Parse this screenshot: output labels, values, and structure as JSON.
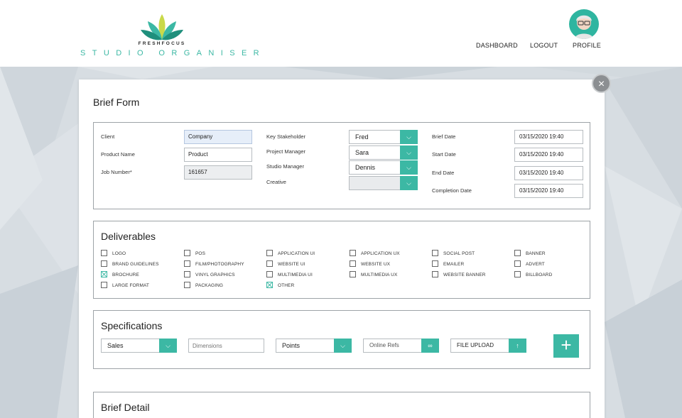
{
  "brand": {
    "small": "FRESHFOCUS",
    "big": "STUDIO ORGANISER"
  },
  "nav": {
    "dashboard": "DASHBOARD",
    "logout": "LOGOUT",
    "profile": "PROFILE"
  },
  "icons": {
    "close": "close-icon",
    "dropdown": "chevron-down-icon",
    "link": "link-icon",
    "upload": "arrow-up-icon",
    "add": "plus-icon"
  },
  "colors": {
    "accent": "#3cb8a4",
    "background": "#d9dee3"
  },
  "form": {
    "title": "Brief Form",
    "client": {
      "label": "Client",
      "value": "Company"
    },
    "product_name": {
      "label": "Product Name",
      "value": "Product"
    },
    "job_number": {
      "label": "Job Number*",
      "value": "161657"
    },
    "key_stakeholder": {
      "label": "Key Stakeholder",
      "value": "Fred"
    },
    "project_manager": {
      "label": "Project Manager",
      "value": "Sara"
    },
    "studio_manager": {
      "label": "Studio Manager",
      "value": "Dennis"
    },
    "creative": {
      "label": "Creative",
      "value": ""
    },
    "brief_date": {
      "label": "Brief Date",
      "value": "03/15/2020 19:40"
    },
    "start_date": {
      "label": "Start Date",
      "value": "03/15/2020 19:40"
    },
    "end_date": {
      "label": "End Date",
      "value": "03/15/2020 19:40"
    },
    "completion_date": {
      "label": "Completion Date",
      "value": "03/15/2020 19:40"
    }
  },
  "deliverables": {
    "title": "Deliverables",
    "items": [
      {
        "label": "LOGO",
        "checked": false
      },
      {
        "label": "BRAND GUIDELINES",
        "checked": false
      },
      {
        "label": "BROCHURE",
        "checked": true
      },
      {
        "label": "LARGE FORMAT",
        "checked": false
      },
      {
        "label": "POS",
        "checked": false
      },
      {
        "label": "FILM/PHOTOGRAPHY",
        "checked": false
      },
      {
        "label": "VINYL GRAPHICS",
        "checked": false
      },
      {
        "label": "PACKAGING",
        "checked": false
      },
      {
        "label": "APPLICATION UI",
        "checked": false
      },
      {
        "label": "WEBSITE UI",
        "checked": false
      },
      {
        "label": "MULTIMEDIA UI",
        "checked": false
      },
      {
        "label": "OTHER",
        "checked": true
      },
      {
        "label": "APPLICATION UX",
        "checked": false
      },
      {
        "label": "WEBSITE UX",
        "checked": false
      },
      {
        "label": "MULTIMEDIA UX",
        "checked": false
      },
      {
        "label": "SOCIAL POST",
        "checked": false
      },
      {
        "label": "EMAILER",
        "checked": false
      },
      {
        "label": "WEBSITE BANNER",
        "checked": false
      },
      {
        "label": "BANNER",
        "checked": false
      },
      {
        "label": "ADVERT",
        "checked": false
      },
      {
        "label": "BILLBOARD",
        "checked": false
      }
    ]
  },
  "specifications": {
    "title": "Specifications",
    "category": "Sales",
    "dimensions_placeholder": "Dimensions",
    "points": "Points",
    "online_refs": "Online Refs",
    "file_upload": "FILE UPLOAD"
  },
  "brief_detail": {
    "title": "Brief Detail"
  }
}
